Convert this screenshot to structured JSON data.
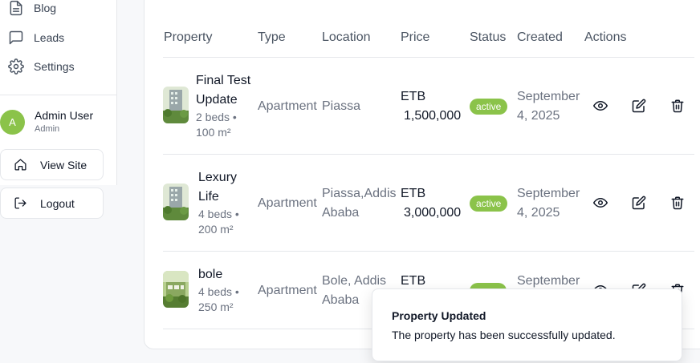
{
  "sidebar": {
    "nav": [
      {
        "label": "Blog",
        "icon": "file-text-icon"
      },
      {
        "label": "Leads",
        "icon": "message-square-icon"
      },
      {
        "label": "Settings",
        "icon": "gear-icon"
      }
    ],
    "user": {
      "initial": "A",
      "name": "Admin User",
      "role": "Admin"
    },
    "view_site_label": "View Site",
    "logout_label": "Logout"
  },
  "table": {
    "headers": [
      "Property",
      "Type",
      "Location",
      "Price",
      "Status",
      "Created",
      "Actions"
    ],
    "rows": [
      {
        "name_line1": "Final Test",
        "name_line2": "Update",
        "meta_line1": "2 beds •",
        "meta_line2": "100 m²",
        "type": "Apartment",
        "location_line1": "Piassa",
        "location_line2": "",
        "price_currency": "ETB",
        "price_amount": "1,500,000",
        "status": "active",
        "created_line1": "September",
        "created_line2": "4, 2025"
      },
      {
        "name_line1": "Lexury",
        "name_line2": "Life",
        "meta_line1": "4 beds •",
        "meta_line2": "200 m²",
        "type": "Apartment",
        "location_line1": "Piassa,Addis",
        "location_line2": "Ababa",
        "price_currency": "ETB",
        "price_amount": "3,000,000",
        "status": "active",
        "created_line1": "September",
        "created_line2": "4, 2025"
      },
      {
        "name_line1": "bole",
        "name_line2": "",
        "meta_line1": "4 beds •",
        "meta_line2": "250 m²",
        "type": "Apartment",
        "location_line1": "Bole, Addis",
        "location_line2": "Ababa",
        "price_currency": "ETB",
        "price_amount": "",
        "status": "",
        "created_line1": "September",
        "created_line2": ""
      }
    ]
  },
  "toast": {
    "title": "Property Updated",
    "description": "The property has been successfully updated."
  },
  "colors": {
    "accent": "#8bc34a",
    "muted_text": "#6b7280"
  }
}
